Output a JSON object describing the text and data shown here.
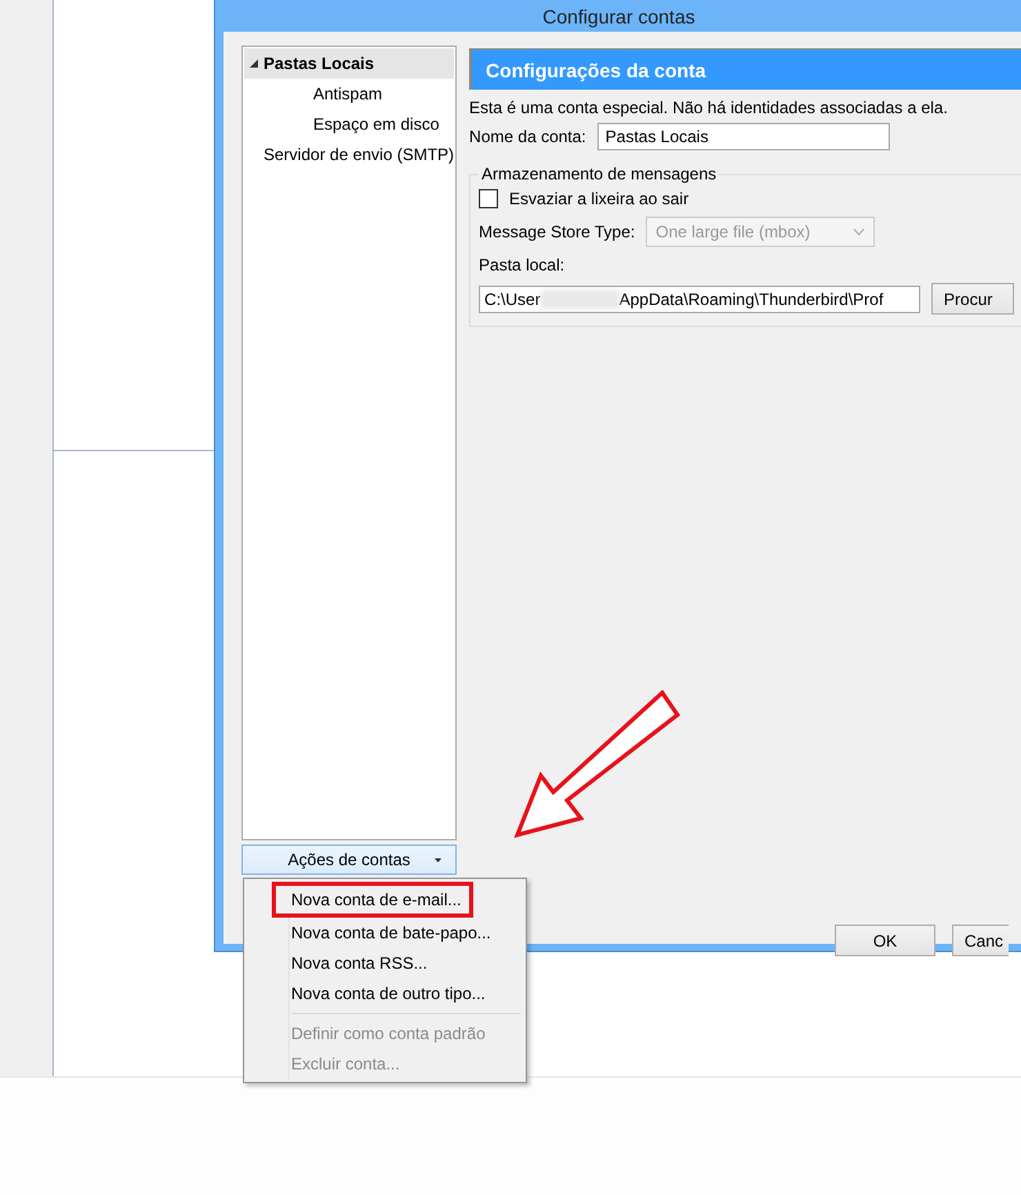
{
  "window": {
    "title": "Configurar contas"
  },
  "tree": {
    "items": [
      {
        "label": "Pastas Locais",
        "selected": true,
        "expanded": true,
        "children": [
          {
            "label": "Antispam",
            "selected": false
          },
          {
            "label": "Espaço em disco",
            "selected": false
          }
        ]
      },
      {
        "label": "Servidor de envio (SMTP)",
        "selected": false
      }
    ]
  },
  "account_actions": {
    "label": "Ações de contas",
    "expanded": true,
    "menu": [
      {
        "label": "Nova conta de e-mail...",
        "disabled": false,
        "highlighted": true
      },
      {
        "label": "Nova conta de bate-papo...",
        "disabled": false,
        "highlighted": false
      },
      {
        "label": "Nova conta RSS...",
        "disabled": false,
        "highlighted": false
      },
      {
        "label": "Nova conta de outro tipo...",
        "disabled": false,
        "highlighted": false
      },
      {
        "label": "Definir como conta padrão",
        "disabled": true,
        "highlighted": false
      },
      {
        "label": "Excluir conta...",
        "disabled": true,
        "highlighted": false
      }
    ]
  },
  "settings": {
    "header": "Configurações da conta",
    "note": "Esta é uma conta especial. Não há identidades associadas a ela.",
    "account_name": {
      "label": "Nome da conta:",
      "value": "Pastas Locais"
    },
    "storage": {
      "legend": "Armazenamento de mensagens",
      "empty_trash": {
        "label": "Esvaziar a lixeira ao sair",
        "checked": false
      },
      "store_type": {
        "label": "Message Store Type:",
        "value": "One large file (mbox)",
        "disabled": true
      },
      "local_folder": {
        "label": "Pasta local:",
        "value_start": "C:\\User",
        "value_end": "AppData\\Roaming\\Thunderbird\\Prof",
        "browse": "Procur"
      }
    }
  },
  "buttons": [
    "OK",
    "Canc"
  ]
}
